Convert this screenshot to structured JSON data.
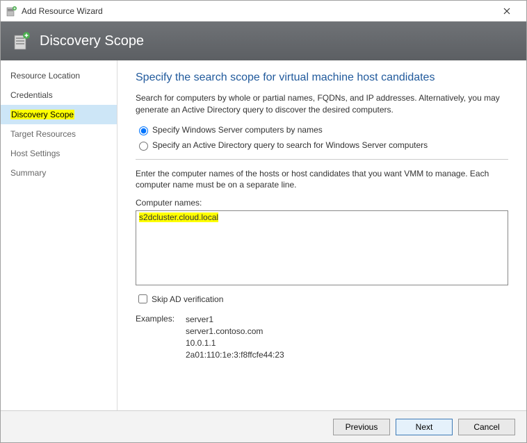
{
  "window": {
    "title": "Add Resource Wizard"
  },
  "banner": {
    "heading": "Discovery Scope"
  },
  "sidebar": {
    "items": [
      {
        "label": "Resource Location"
      },
      {
        "label": "Credentials"
      },
      {
        "label": "Discovery Scope"
      },
      {
        "label": "Target Resources"
      },
      {
        "label": "Host Settings"
      },
      {
        "label": "Summary"
      }
    ]
  },
  "main": {
    "heading": "Specify the search scope for virtual machine host candidates",
    "description": "Search for computers by whole or partial names, FQDNs, and IP addresses. Alternatively, you may generate an Active Directory query to discover the desired computers.",
    "radio1": "Specify Windows Server computers by names",
    "radio2": "Specify an Active Directory query to search for Windows Server computers",
    "instruction": "Enter the computer names of the hosts or host candidates that you want VMM to manage. Each computer name must be on a separate line.",
    "computer_names_label": "Computer names:",
    "computer_names_value": "s2dcluster.cloud.local",
    "skip_ad_label": "Skip AD verification",
    "examples_label": "Examples:",
    "examples": [
      "server1",
      "server1.contoso.com",
      "10.0.1.1",
      "2a01:110:1e:3:f8ffcfe44:23"
    ]
  },
  "footer": {
    "previous": "Previous",
    "next": "Next",
    "cancel": "Cancel"
  }
}
